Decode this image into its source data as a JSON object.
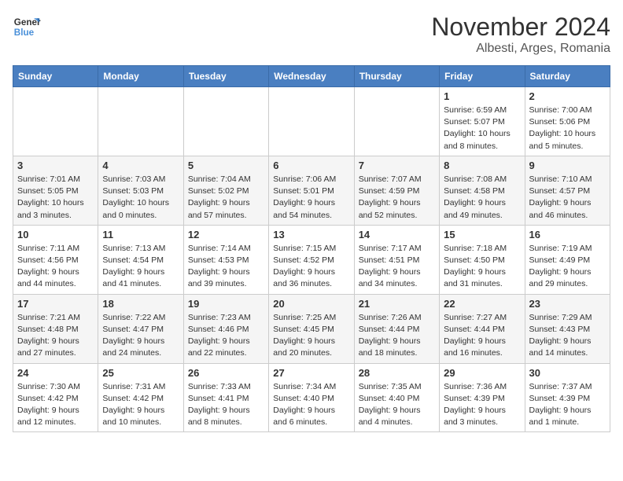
{
  "logo": {
    "line1": "General",
    "line2": "Blue"
  },
  "title": "November 2024",
  "subtitle": "Albesti, Arges, Romania",
  "days_of_week": [
    "Sunday",
    "Monday",
    "Tuesday",
    "Wednesday",
    "Thursday",
    "Friday",
    "Saturday"
  ],
  "weeks": [
    [
      {
        "day": "",
        "info": ""
      },
      {
        "day": "",
        "info": ""
      },
      {
        "day": "",
        "info": ""
      },
      {
        "day": "",
        "info": ""
      },
      {
        "day": "",
        "info": ""
      },
      {
        "day": "1",
        "info": "Sunrise: 6:59 AM\nSunset: 5:07 PM\nDaylight: 10 hours\nand 8 minutes."
      },
      {
        "day": "2",
        "info": "Sunrise: 7:00 AM\nSunset: 5:06 PM\nDaylight: 10 hours\nand 5 minutes."
      }
    ],
    [
      {
        "day": "3",
        "info": "Sunrise: 7:01 AM\nSunset: 5:05 PM\nDaylight: 10 hours\nand 3 minutes."
      },
      {
        "day": "4",
        "info": "Sunrise: 7:03 AM\nSunset: 5:03 PM\nDaylight: 10 hours\nand 0 minutes."
      },
      {
        "day": "5",
        "info": "Sunrise: 7:04 AM\nSunset: 5:02 PM\nDaylight: 9 hours\nand 57 minutes."
      },
      {
        "day": "6",
        "info": "Sunrise: 7:06 AM\nSunset: 5:01 PM\nDaylight: 9 hours\nand 54 minutes."
      },
      {
        "day": "7",
        "info": "Sunrise: 7:07 AM\nSunset: 4:59 PM\nDaylight: 9 hours\nand 52 minutes."
      },
      {
        "day": "8",
        "info": "Sunrise: 7:08 AM\nSunset: 4:58 PM\nDaylight: 9 hours\nand 49 minutes."
      },
      {
        "day": "9",
        "info": "Sunrise: 7:10 AM\nSunset: 4:57 PM\nDaylight: 9 hours\nand 46 minutes."
      }
    ],
    [
      {
        "day": "10",
        "info": "Sunrise: 7:11 AM\nSunset: 4:56 PM\nDaylight: 9 hours\nand 44 minutes."
      },
      {
        "day": "11",
        "info": "Sunrise: 7:13 AM\nSunset: 4:54 PM\nDaylight: 9 hours\nand 41 minutes."
      },
      {
        "day": "12",
        "info": "Sunrise: 7:14 AM\nSunset: 4:53 PM\nDaylight: 9 hours\nand 39 minutes."
      },
      {
        "day": "13",
        "info": "Sunrise: 7:15 AM\nSunset: 4:52 PM\nDaylight: 9 hours\nand 36 minutes."
      },
      {
        "day": "14",
        "info": "Sunrise: 7:17 AM\nSunset: 4:51 PM\nDaylight: 9 hours\nand 34 minutes."
      },
      {
        "day": "15",
        "info": "Sunrise: 7:18 AM\nSunset: 4:50 PM\nDaylight: 9 hours\nand 31 minutes."
      },
      {
        "day": "16",
        "info": "Sunrise: 7:19 AM\nSunset: 4:49 PM\nDaylight: 9 hours\nand 29 minutes."
      }
    ],
    [
      {
        "day": "17",
        "info": "Sunrise: 7:21 AM\nSunset: 4:48 PM\nDaylight: 9 hours\nand 27 minutes."
      },
      {
        "day": "18",
        "info": "Sunrise: 7:22 AM\nSunset: 4:47 PM\nDaylight: 9 hours\nand 24 minutes."
      },
      {
        "day": "19",
        "info": "Sunrise: 7:23 AM\nSunset: 4:46 PM\nDaylight: 9 hours\nand 22 minutes."
      },
      {
        "day": "20",
        "info": "Sunrise: 7:25 AM\nSunset: 4:45 PM\nDaylight: 9 hours\nand 20 minutes."
      },
      {
        "day": "21",
        "info": "Sunrise: 7:26 AM\nSunset: 4:44 PM\nDaylight: 9 hours\nand 18 minutes."
      },
      {
        "day": "22",
        "info": "Sunrise: 7:27 AM\nSunset: 4:44 PM\nDaylight: 9 hours\nand 16 minutes."
      },
      {
        "day": "23",
        "info": "Sunrise: 7:29 AM\nSunset: 4:43 PM\nDaylight: 9 hours\nand 14 minutes."
      }
    ],
    [
      {
        "day": "24",
        "info": "Sunrise: 7:30 AM\nSunset: 4:42 PM\nDaylight: 9 hours\nand 12 minutes."
      },
      {
        "day": "25",
        "info": "Sunrise: 7:31 AM\nSunset: 4:42 PM\nDaylight: 9 hours\nand 10 minutes."
      },
      {
        "day": "26",
        "info": "Sunrise: 7:33 AM\nSunset: 4:41 PM\nDaylight: 9 hours\nand 8 minutes."
      },
      {
        "day": "27",
        "info": "Sunrise: 7:34 AM\nSunset: 4:40 PM\nDaylight: 9 hours\nand 6 minutes."
      },
      {
        "day": "28",
        "info": "Sunrise: 7:35 AM\nSunset: 4:40 PM\nDaylight: 9 hours\nand 4 minutes."
      },
      {
        "day": "29",
        "info": "Sunrise: 7:36 AM\nSunset: 4:39 PM\nDaylight: 9 hours\nand 3 minutes."
      },
      {
        "day": "30",
        "info": "Sunrise: 7:37 AM\nSunset: 4:39 PM\nDaylight: 9 hours\nand 1 minute."
      }
    ]
  ]
}
